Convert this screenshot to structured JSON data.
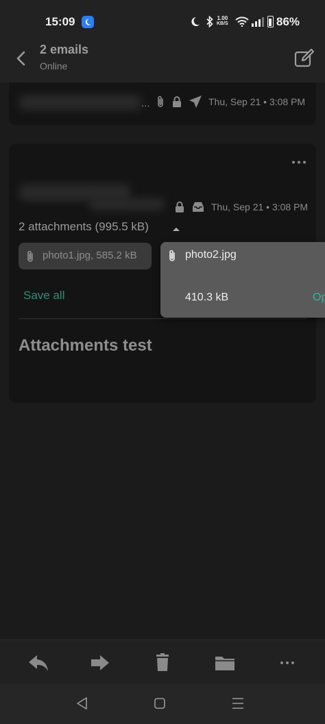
{
  "status_bar": {
    "time": "15:09",
    "speed_value": "1.00",
    "speed_unit": "KB/S",
    "battery": "86%",
    "battery_level": 0.86,
    "icons": [
      "moon-app-icon",
      "do-not-disturb-moon-icon",
      "bluetooth-icon",
      "wifi-icon",
      "signal-icon",
      "battery-icon"
    ]
  },
  "header": {
    "title": "2 emails",
    "subtitle": "Online",
    "icons": [
      "back-arrow-icon",
      "compose-icon"
    ]
  },
  "email_1": {
    "ellipsis": "...",
    "date": "Thu, Sep 21 • 3:08 PM",
    "icons": [
      "attachment-icon",
      "lock-icon",
      "sent-icon"
    ]
  },
  "email_2": {
    "date": "Thu, Sep 21 • 3:08 PM",
    "attachments_summary": "2 attachments (995.5 kB)",
    "attachment_1": "photo1.jpg, 585.2 kB",
    "save_all": "Save all",
    "subject": "Attachments test",
    "icons": [
      "more-options-icon",
      "lock-icon",
      "inbox-icon",
      "collapse-caret-icon",
      "attachment-icon"
    ]
  },
  "attachment_popup": {
    "name": "photo2.jpg",
    "size": "410.3 kB",
    "action": "Op"
  },
  "action_bar": {
    "icons": [
      "reply-icon",
      "forward-icon",
      "delete-icon",
      "move-to-folder-icon",
      "more-icon"
    ]
  },
  "nav_bar": {
    "icons": [
      "nav-back-icon",
      "nav-home-icon",
      "nav-recents-icon"
    ]
  },
  "colors": {
    "accent": "#2f8f74",
    "accent_bright": "#2fb99a",
    "background": "#1b1b1b",
    "card": "#141414"
  }
}
